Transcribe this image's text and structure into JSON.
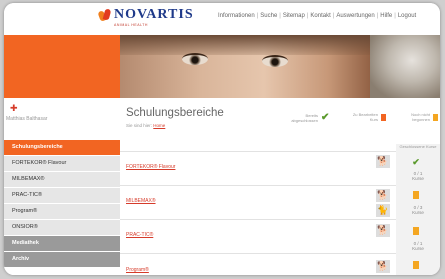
{
  "brand": {
    "name": "NOVARTIS",
    "sub": "ANIMAL HEALTH"
  },
  "topnav": {
    "items": [
      "Informationen",
      "Suche",
      "Sitemap",
      "Kontakt",
      "Auswertungen",
      "Hilfe",
      "Logout"
    ]
  },
  "user": {
    "name": "Matthias Balthasar"
  },
  "sidebar": {
    "items": [
      {
        "label": "Schulungsbereiche",
        "state": "active"
      },
      {
        "label": "FORTEKOR® Flavour",
        "state": "normal"
      },
      {
        "label": "MILBEMAX®",
        "state": "normal"
      },
      {
        "label": "PRAC-TIC®",
        "state": "normal"
      },
      {
        "label": "Program®",
        "state": "normal"
      },
      {
        "label": "ONSIOR®",
        "state": "normal"
      },
      {
        "label": "Mediathek",
        "state": "dark"
      },
      {
        "label": "Archiv",
        "state": "dark"
      }
    ]
  },
  "main": {
    "title": "Schulungsbereiche",
    "breadcrumb_prefix": "Sie sind hier:",
    "breadcrumb_link": "Home",
    "legend": [
      {
        "text": "Bereits abgeschlossen",
        "icon": "check-icon"
      },
      {
        "text": "Zu Bearbeiten Kurs",
        "icon": "document-orange-icon"
      },
      {
        "text": "Noch nicht begonnen",
        "icon": "document-yellow-icon"
      }
    ],
    "rows": [
      {
        "label": "FORTEKOR® Flavour",
        "animals": [
          "dog-icon"
        ]
      },
      {
        "label": "MILBEMAX®",
        "animals": [
          "dog-icon",
          "cat-icon"
        ]
      },
      {
        "label": "PRAC-TIC®",
        "animals": [
          "dog-icon"
        ]
      },
      {
        "label": "Program®",
        "animals": [
          "dog-icon"
        ]
      }
    ],
    "side_column": {
      "header": "Geschlossene Kurse",
      "entries": [
        {
          "icon": "check-icon",
          "count": "0 / 1",
          "unit": "Kurse"
        },
        {
          "icon": "document-yellow-icon",
          "count": "0 / 3",
          "unit": "Kurse"
        },
        {
          "icon": "document-yellow-icon",
          "count": "0 / 1",
          "unit": "Kurse"
        },
        {
          "icon": "document-yellow-icon",
          "count": "",
          "unit": ""
        }
      ]
    }
  },
  "colors": {
    "accent": "#f26522",
    "brand_blue": "#1f3a8a",
    "link_red": "#d63b2a",
    "check_green": "#5b9a2d"
  }
}
